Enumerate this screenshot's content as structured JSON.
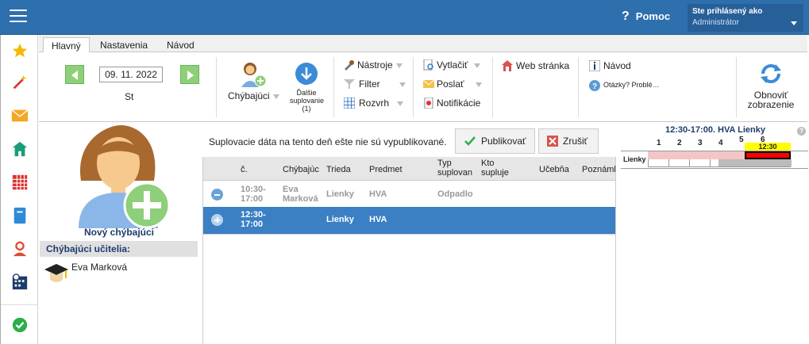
{
  "header": {
    "help_label": "Pomoc",
    "user_line1": "Ste prihlásený ako",
    "user_line2": "Administrátor"
  },
  "tabs": [
    {
      "label": "Hlavný"
    },
    {
      "label": "Nastavenia"
    },
    {
      "label": "Návod"
    }
  ],
  "ribbon": {
    "date": "09. 11. 2022",
    "day": "St",
    "absent_label": "Chýbajúci",
    "next_label_line1": "Ďalšie",
    "next_label_line2": "suplovanie",
    "next_label_line3": "(1)",
    "tools_label": "Nástroje",
    "filter_label": "Filter",
    "schedule_label": "Rozvrh",
    "print_label": "Vytlačiť",
    "send_label": "Poslať",
    "notify_label": "Notifikácie",
    "web_label": "Web stránka",
    "guide_label": "Návod",
    "questions_label": "Otázky? Problé…",
    "refresh_line1": "Obnoviť",
    "refresh_line2": "zobrazenie"
  },
  "left": {
    "new_absent": "Nový chýbajúci",
    "absent_teachers_header": "Chýbajúci učitelia:",
    "teachers": [
      "Eva Marková"
    ]
  },
  "main": {
    "message": "Suplovacie dáta na tento deň ešte nie sú vypublikované.",
    "publish_label": "Publikovať",
    "cancel_label": "Zrušiť"
  },
  "table": {
    "headers": [
      "č.",
      "Chýbajúci",
      "Trieda",
      "Predmet",
      "Typ suplovan",
      "Kto supluje",
      "Učebňa",
      "Poznámk"
    ],
    "rows": [
      {
        "time": "10:30-17:00",
        "absent": "Eva Marková",
        "class": "Lienky",
        "subject": "HVA",
        "type": "Odpadlo",
        "sub": "",
        "room": "",
        "note": ""
      },
      {
        "time": "12:30-17:00",
        "absent": "",
        "class": "Lienky",
        "subject": "HVA",
        "type": "",
        "sub": "",
        "room": "",
        "note": ""
      }
    ]
  },
  "schedule": {
    "title": "12:30-17:00. HVA Lienky",
    "periods": [
      "1",
      "2",
      "3",
      "4",
      "5",
      "6"
    ],
    "row_label": "Lienky",
    "highlight_time": "12:30"
  },
  "colors": {
    "header": "#2e6fae",
    "selected_row": "#3b7fc4",
    "accent_red": "#ff0000",
    "accent_yellow": "#ffff00"
  }
}
